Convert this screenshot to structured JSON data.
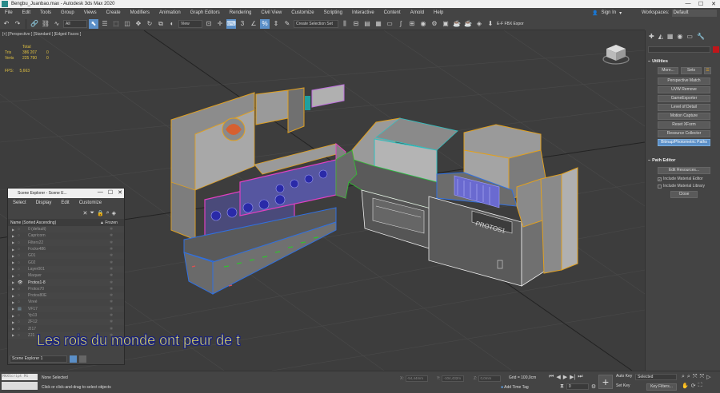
{
  "window": {
    "title": "Bengbu_Juanbao.max - Autodesk 3ds Max 2020",
    "controls": [
      "—",
      "☐",
      "✕"
    ]
  },
  "menu": [
    "File",
    "Edit",
    "Tools",
    "Group",
    "Views",
    "Create",
    "Modifiers",
    "Animation",
    "Graph Editors",
    "Rendering",
    "Civil View",
    "Customize",
    "Scripting",
    "Interactive",
    "Content",
    "Arnold",
    "Help"
  ],
  "account": {
    "signin": "Sign In",
    "workspaces_label": "Workspaces:",
    "workspace": "Default"
  },
  "toolbar": {
    "filter": "All",
    "view": "View",
    "selection_set": "Create Selection Set",
    "fbx_export": "E-F FBX Expor"
  },
  "viewport": {
    "label": "[+] [Perspective ] [Standard ] [Edged Faces ]",
    "stats_header": "Total",
    "stats": [
      {
        "label": "Tris",
        "total": "386 207",
        "sel": "0"
      },
      {
        "label": "Verts",
        "total": "225 790",
        "sel": "0"
      }
    ],
    "fps_label": "FPS:",
    "fps_value": "5,663"
  },
  "scene_explorer": {
    "title": "Scene Explorer - Scene E...",
    "menu": [
      "Select",
      "Display",
      "Edit",
      "Customize"
    ],
    "col_name": "Name (Sorted Ascending)",
    "col_frozen": "▲ Frozen",
    "rows": [
      {
        "name": "0 (default)",
        "visible": false
      },
      {
        "name": "Capricorn",
        "visible": false
      },
      {
        "name": "Filters22",
        "visible": false
      },
      {
        "name": "Focke486",
        "visible": false
      },
      {
        "name": "G01",
        "visible": false
      },
      {
        "name": "G02",
        "visible": false
      },
      {
        "name": "Layer001",
        "visible": false
      },
      {
        "name": "Maquer",
        "visible": false
      },
      {
        "name": "Protos1-8",
        "visible": true
      },
      {
        "name": "Protos70",
        "visible": false
      },
      {
        "name": "Protos80E",
        "visible": false
      },
      {
        "name": "Vireé",
        "visible": false
      },
      {
        "name": "VF17",
        "visible": false
      },
      {
        "name": "Yp13",
        "visible": false
      },
      {
        "name": "ZF12",
        "visible": false
      },
      {
        "name": "ZI17",
        "visible": false
      },
      {
        "name": "ZJ1",
        "visible": false
      }
    ],
    "explorer_name": "Scene Explorer 1"
  },
  "subtitle": "Les rois du monde ont peur de t",
  "command_panel": {
    "utilities": {
      "header": "Utilities",
      "more": "More...",
      "sets": "Sets",
      "items": [
        "Perspective Match",
        "UVW Remove",
        "GameExporter",
        "Level of Detail",
        "Motion Capture",
        "Reset XForm",
        "Resource Collector",
        "Bitmap/Photometric Paths"
      ],
      "active_index": 7
    },
    "path_editor": {
      "header": "Path Editor",
      "edit_resources": "Edit Resources...",
      "include_material_editor": "Include Material Editor",
      "include_material_library": "Include Material Library",
      "close": "Close"
    }
  },
  "status": {
    "maxscript": "MAXScript Mi",
    "selection": "None Selected",
    "prompt": "Click or click-and-drag to select objects",
    "x_value": "-54,44mm",
    "y_value": "-104,432m",
    "z_value": "0,0mm",
    "grid": "Grid = 100,0cm",
    "add_time_tag": "Add Time Tag",
    "auto_key": "Auto Key",
    "set_key": "Set Key",
    "selected": "Selected",
    "key_filters": "Key Filters...",
    "frame": "0"
  }
}
